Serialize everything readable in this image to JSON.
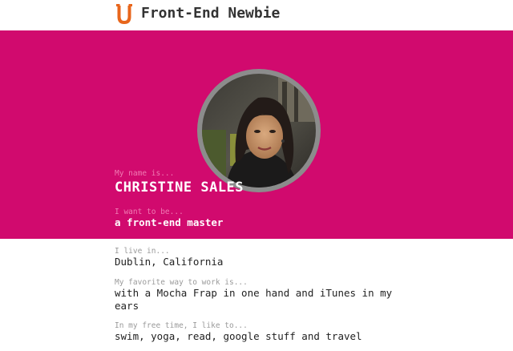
{
  "header": {
    "logo_icon": "letter-u-logo-icon",
    "brand": "Front-End Newbie",
    "accent_color": "#e8661c"
  },
  "profile": {
    "hero_color": "#d10a6e",
    "name_label": "My name is...",
    "name": "CHRISTINE SALES",
    "goal_label": "I want to be...",
    "goal": "a front-end master",
    "location_label": "I live in...",
    "location": "Dublin, California",
    "work_label": "My favorite way to work is...",
    "work": "with a Mocha Frap in one hand and iTunes in my ears",
    "free_time_label": "In my free time, I like to...",
    "free_time": "swim, yoga, read, google stuff and travel"
  }
}
